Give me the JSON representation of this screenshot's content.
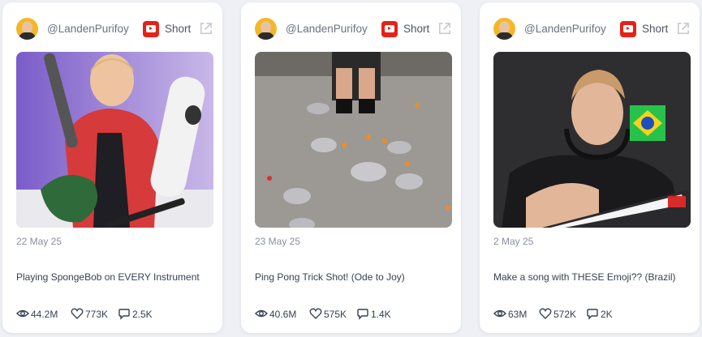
{
  "cards": [
    {
      "handle": "@LandenPurifoy",
      "type_label": "Short",
      "date": "22 May 25",
      "title": "Playing SpongeBob on EVERY Instrument",
      "views": "44.2M",
      "likes": "773K",
      "comments": "2.5K"
    },
    {
      "handle": "@LandenPurifoy",
      "type_label": "Short",
      "date": "23 May 25",
      "title": "Ping Pong Trick Shot! (Ode to Joy)",
      "views": "40.6M",
      "likes": "575K",
      "comments": "1.4K"
    },
    {
      "handle": "@LandenPurifoy",
      "type_label": "Short",
      "date": "2 May 25",
      "title": "Make a song with THESE Emoji?? (Brazil)",
      "views": "63M",
      "likes": "572K",
      "comments": "2K"
    }
  ],
  "colors": {
    "youtube_red": "#e62117",
    "text_muted": "#8a8fa0",
    "background": "#eef0f5"
  },
  "icons": [
    "avatar",
    "youtube-icon",
    "external-link-icon",
    "eye-icon",
    "heart-icon",
    "comment-icon"
  ]
}
